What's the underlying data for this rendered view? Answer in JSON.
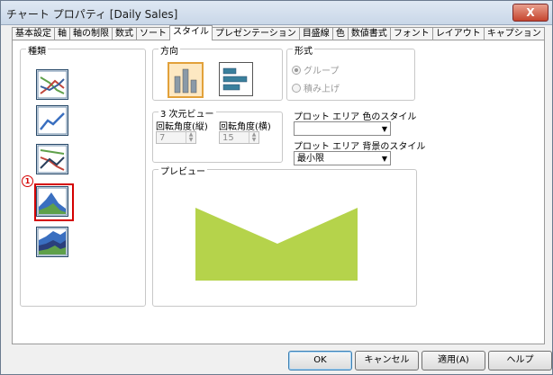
{
  "window": {
    "title": "チャート プロパティ [Daily Sales]",
    "close_glyph": "X"
  },
  "tabs": [
    {
      "label": "基本設定"
    },
    {
      "label": "軸"
    },
    {
      "label": "軸の制限"
    },
    {
      "label": "数式"
    },
    {
      "label": "ソート"
    },
    {
      "label": "スタイル",
      "active": true
    },
    {
      "label": "プレゼンテーション"
    },
    {
      "label": "目盛線"
    },
    {
      "label": "色"
    },
    {
      "label": "数値書式"
    },
    {
      "label": "フォント"
    },
    {
      "label": "レイアウト"
    },
    {
      "label": "キャプション"
    }
  ],
  "style": {
    "type_label": "種類",
    "selected_marker": "1",
    "chart_types": [
      "line-chart-icon",
      "line-chart-icon",
      "line-chart-icon",
      "area-chart-icon",
      "stacked-area-chart-icon"
    ],
    "direction_label": "方向",
    "form_label": "形式",
    "group_option": "グループ",
    "stack_option": "積み上げ",
    "view3d_label": "3 次元ビュー",
    "rot_vertical_label": "回転角度(縦)",
    "rot_vertical_value": "7",
    "rot_horizontal_label": "回転角度(横)",
    "rot_horizontal_value": "15",
    "plot_color_label": "プロット エリア 色のスタイル",
    "plot_color_value": "",
    "plot_bg_label": "プロット エリア 背景のスタイル",
    "plot_bg_value": "最小限",
    "preview_label": "プレビュー",
    "preview_color": "#b5d34b"
  },
  "buttons": {
    "ok": "OK",
    "cancel": "キャンセル",
    "apply": "適用(A)",
    "help": "ヘルプ"
  }
}
